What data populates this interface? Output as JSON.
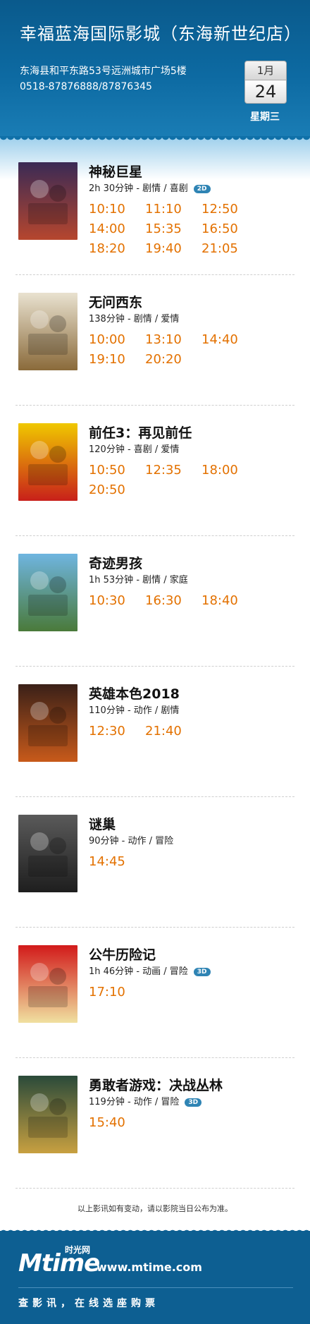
{
  "header": {
    "cinema_name": "幸福蓝海国际影城（东海新世纪店）",
    "address": "东海县和平东路53号远洲城市广场5楼",
    "phone": "0518-87876888/87876345",
    "month": "1月",
    "day": "24",
    "weekday": "星期三"
  },
  "movies": [
    {
      "title": "神秘巨星",
      "info": "2h 30分钟 - 剧情 / 喜剧",
      "badge": "2D",
      "times": [
        "10:10",
        "11:10",
        "12:50",
        "14:00",
        "15:35",
        "16:50",
        "18:20",
        "19:40",
        "21:05"
      ],
      "poster_colors": [
        "#3a2a55",
        "#b6462e"
      ]
    },
    {
      "title": "无问西东",
      "info": "138分钟 - 剧情 / 爱情",
      "badge": "",
      "times": [
        "10:00",
        "13:10",
        "14:40",
        "19:10",
        "20:20"
      ],
      "poster_colors": [
        "#e9e2d0",
        "#8a6a3a"
      ]
    },
    {
      "title": "前任3：再见前任",
      "info": "120分钟 - 喜剧 / 爱情",
      "badge": "",
      "times": [
        "10:50",
        "12:35",
        "18:00",
        "20:50"
      ],
      "poster_colors": [
        "#f0c800",
        "#c8201a"
      ]
    },
    {
      "title": "奇迹男孩",
      "info": "1h 53分钟 - 剧情 / 家庭",
      "badge": "",
      "times": [
        "10:30",
        "16:30",
        "18:40"
      ],
      "poster_colors": [
        "#6fb5e0",
        "#4a7a3a"
      ]
    },
    {
      "title": "英雄本色2018",
      "info": "110分钟 - 动作 / 剧情",
      "badge": "",
      "times": [
        "12:30",
        "21:40"
      ],
      "poster_colors": [
        "#3a2018",
        "#c85a1a"
      ]
    },
    {
      "title": "谜巢",
      "info": "90分钟 - 动作 / 冒险",
      "badge": "",
      "times": [
        "14:45"
      ],
      "poster_colors": [
        "#5a5a5a",
        "#1e1e1e"
      ]
    },
    {
      "title": "公牛历险记",
      "info": "1h 46分钟 - 动画 / 冒险",
      "badge": "3D",
      "times": [
        "17:10"
      ],
      "poster_colors": [
        "#d21a1a",
        "#f0e0a0"
      ]
    },
    {
      "title": "勇敢者游戏：决战丛林",
      "info": "119分钟 - 动作 / 冒险",
      "badge": "3D",
      "times": [
        "15:40"
      ],
      "poster_colors": [
        "#2a4a3a",
        "#c8a040"
      ]
    }
  ],
  "note": "以上影讯如有变动，请以影院当日公布为准。",
  "footer": {
    "logo": "Mtime",
    "logo_cn": "时光网",
    "site": "www.mtime.com",
    "slogan": "查影讯，在线选座购票"
  }
}
